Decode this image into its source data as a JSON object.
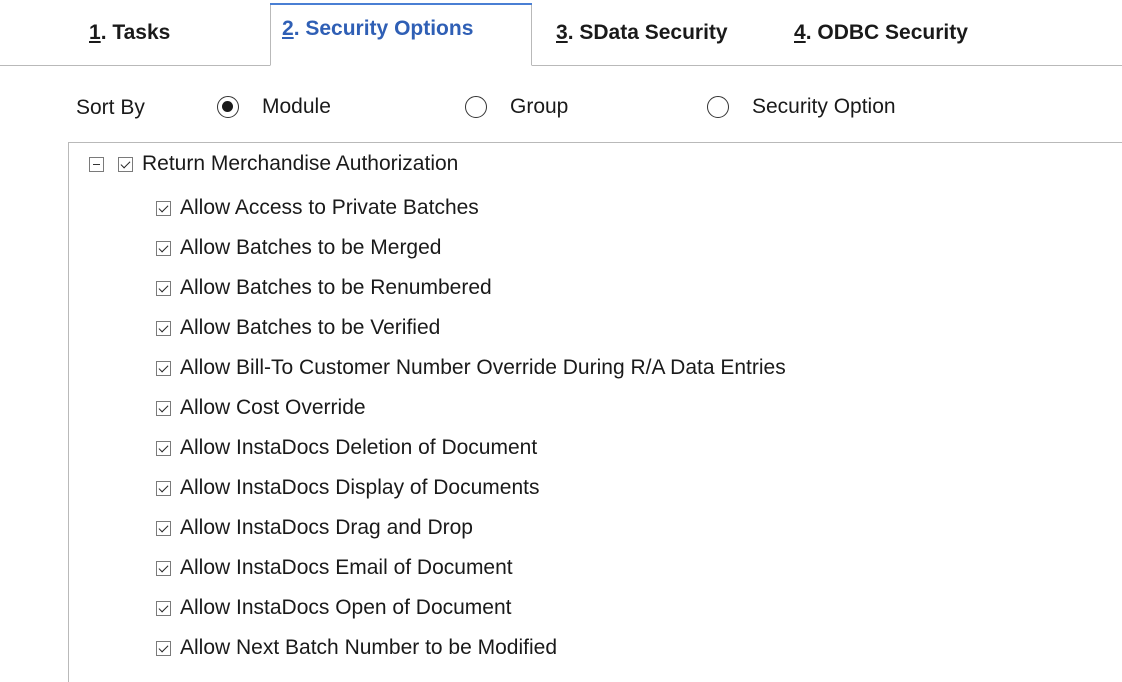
{
  "tabs": [
    {
      "num": "1",
      "text": ". Tasks",
      "active": false
    },
    {
      "num": "2",
      "text": ". Security Options",
      "active": true
    },
    {
      "num": "3",
      "text": ". SData Security",
      "active": false
    },
    {
      "num": "4",
      "text": ". ODBC Security",
      "active": false
    }
  ],
  "sort": {
    "label": "Sort By",
    "options": [
      "Module",
      "Group",
      "Security Option"
    ],
    "selected": "Module"
  },
  "tree": {
    "root": {
      "label": "Return Merchandise Authorization",
      "expanded": true,
      "checked": true
    },
    "children": [
      {
        "label": "Allow Access to Private Batches",
        "checked": true
      },
      {
        "label": "Allow Batches to be Merged",
        "checked": true
      },
      {
        "label": "Allow Batches to be Renumbered",
        "checked": true
      },
      {
        "label": "Allow Batches to be Verified",
        "checked": true
      },
      {
        "label": "Allow Bill-To Customer Number Override During R/A Data Entries",
        "checked": true
      },
      {
        "label": "Allow Cost Override",
        "checked": true
      },
      {
        "label": "Allow InstaDocs Deletion of Document",
        "checked": true
      },
      {
        "label": "Allow InstaDocs Display of Documents",
        "checked": true
      },
      {
        "label": "Allow InstaDocs Drag and Drop",
        "checked": true
      },
      {
        "label": "Allow InstaDocs Email of Document",
        "checked": true
      },
      {
        "label": "Allow InstaDocs Open of Document",
        "checked": true
      },
      {
        "label": "Allow Next Batch Number to be Modified",
        "checked": true
      }
    ]
  },
  "colors": {
    "active_tab_text": "#2f5fb5",
    "active_tab_accent": "#4a7fd4",
    "border": "#b9b9b9"
  }
}
